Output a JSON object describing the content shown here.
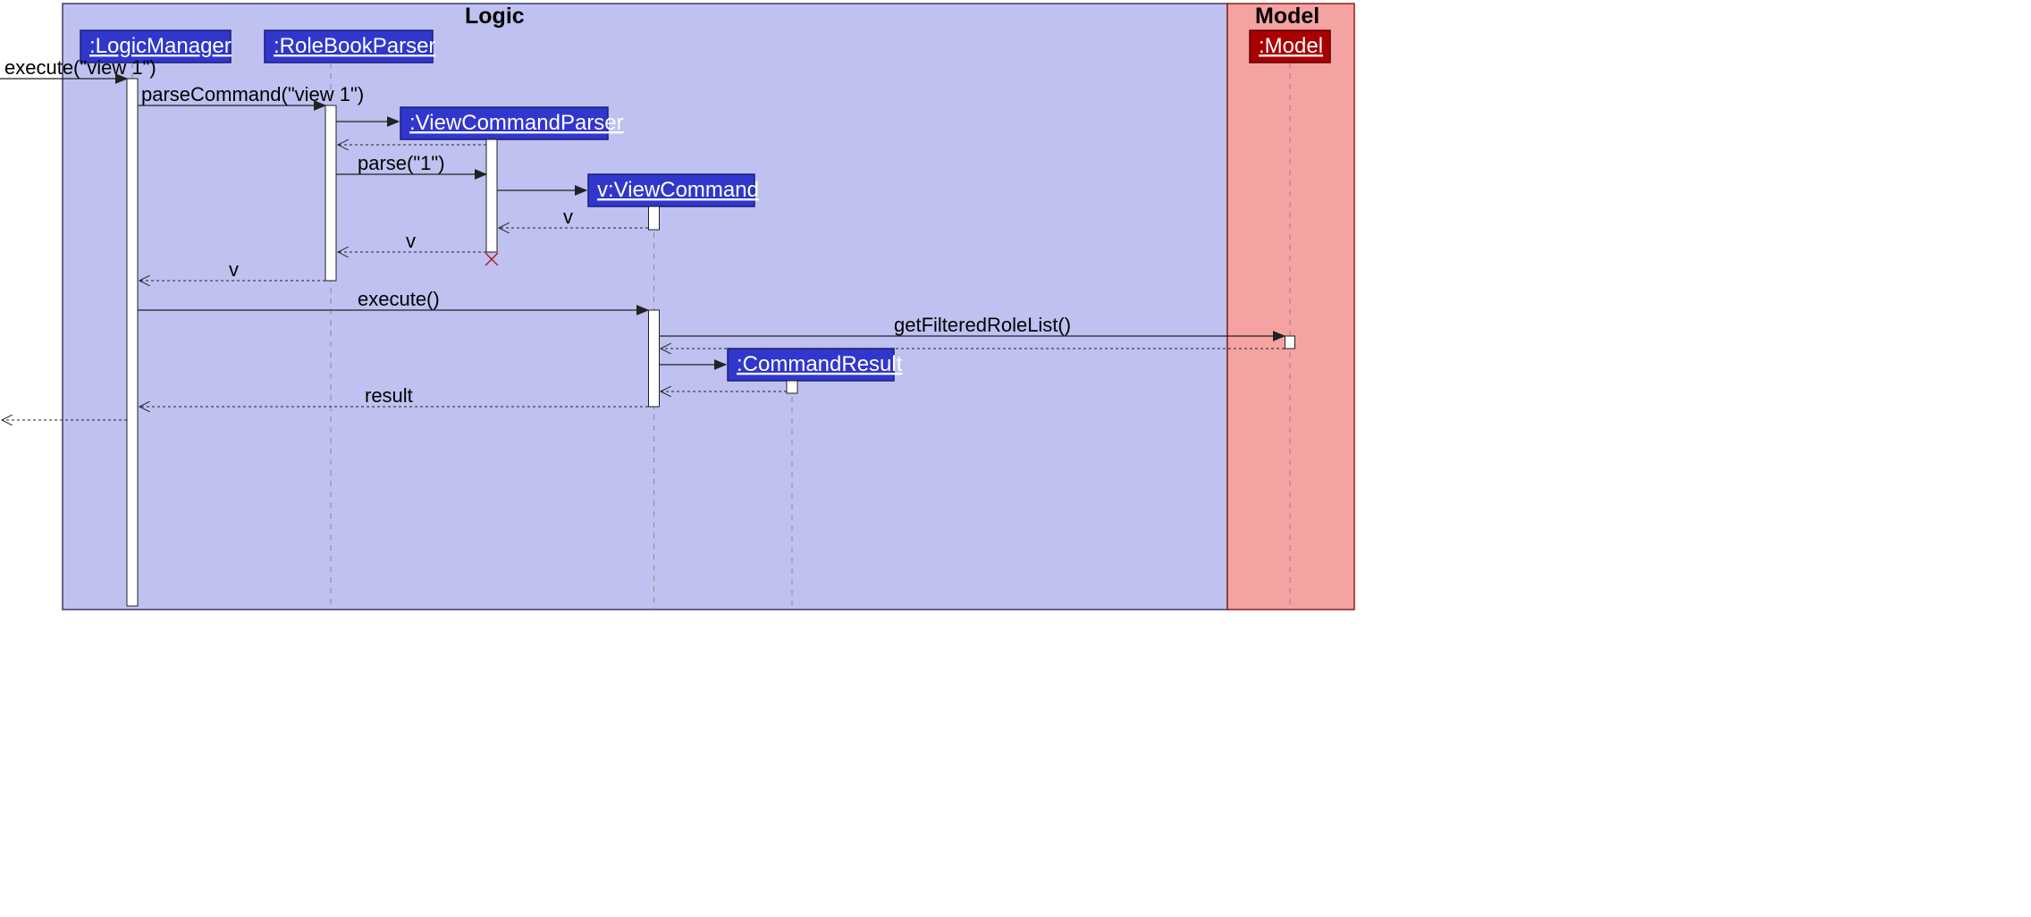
{
  "frames": {
    "logic": {
      "title": "Logic"
    },
    "model": {
      "title": "Model"
    }
  },
  "participants": {
    "logicManager": {
      "label": ":LogicManager"
    },
    "roleBookParser": {
      "label": ":RoleBookParser"
    },
    "viewCommandParser": {
      "label": ":ViewCommandParser"
    },
    "viewCommand": {
      "label": "v:ViewCommand"
    },
    "commandResult": {
      "label": ":CommandResult"
    },
    "model": {
      "label": ":Model"
    }
  },
  "messages": {
    "m1": "execute(\"view 1\")",
    "m2": "parseCommand(\"view 1\")",
    "m3": "parse(\"1\")",
    "m4": "v",
    "m5": "v",
    "m6": "v",
    "m7": "execute()",
    "m8": "getFilteredRoleList()",
    "m9": "result"
  },
  "colors": {
    "logicFrameFill": "#bfc1f0",
    "logicFrameStroke": "#3a3a6a",
    "modelFrameFill": "#f5a2a2",
    "modelFrameStroke": "#8b1e1e",
    "modelHeadFill": "#a80000",
    "headFill": "#3137cc"
  }
}
